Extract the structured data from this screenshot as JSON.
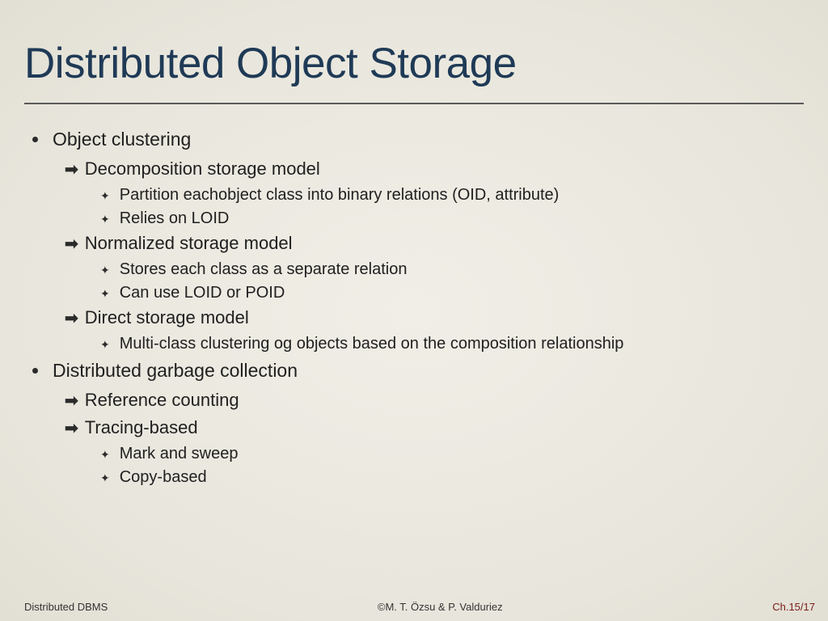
{
  "title": "Distributed Object Storage",
  "bullets": {
    "b1": "Object clustering",
    "b1a": "Decomposition storage model",
    "b1a1": "Partition eachobject class into binary relations (OID, attribute)",
    "b1a2": "Relies on LOID",
    "b1b": "Normalized storage model",
    "b1b1": "Stores each class as a separate relation",
    "b1b2": "Can use LOID or POID",
    "b1c": "Direct storage model",
    "b1c1": "Multi-class clustering og objects based on the composition relationship",
    "b2": "Distributed garbage collection",
    "b2a": "Reference counting",
    "b2b": "Tracing-based",
    "b2b1": "Mark and sweep",
    "b2b2": "Copy-based"
  },
  "footer": {
    "left": "Distributed DBMS",
    "center": "©M. T. Özsu & P. Valduriez",
    "right": "Ch.15/17"
  }
}
